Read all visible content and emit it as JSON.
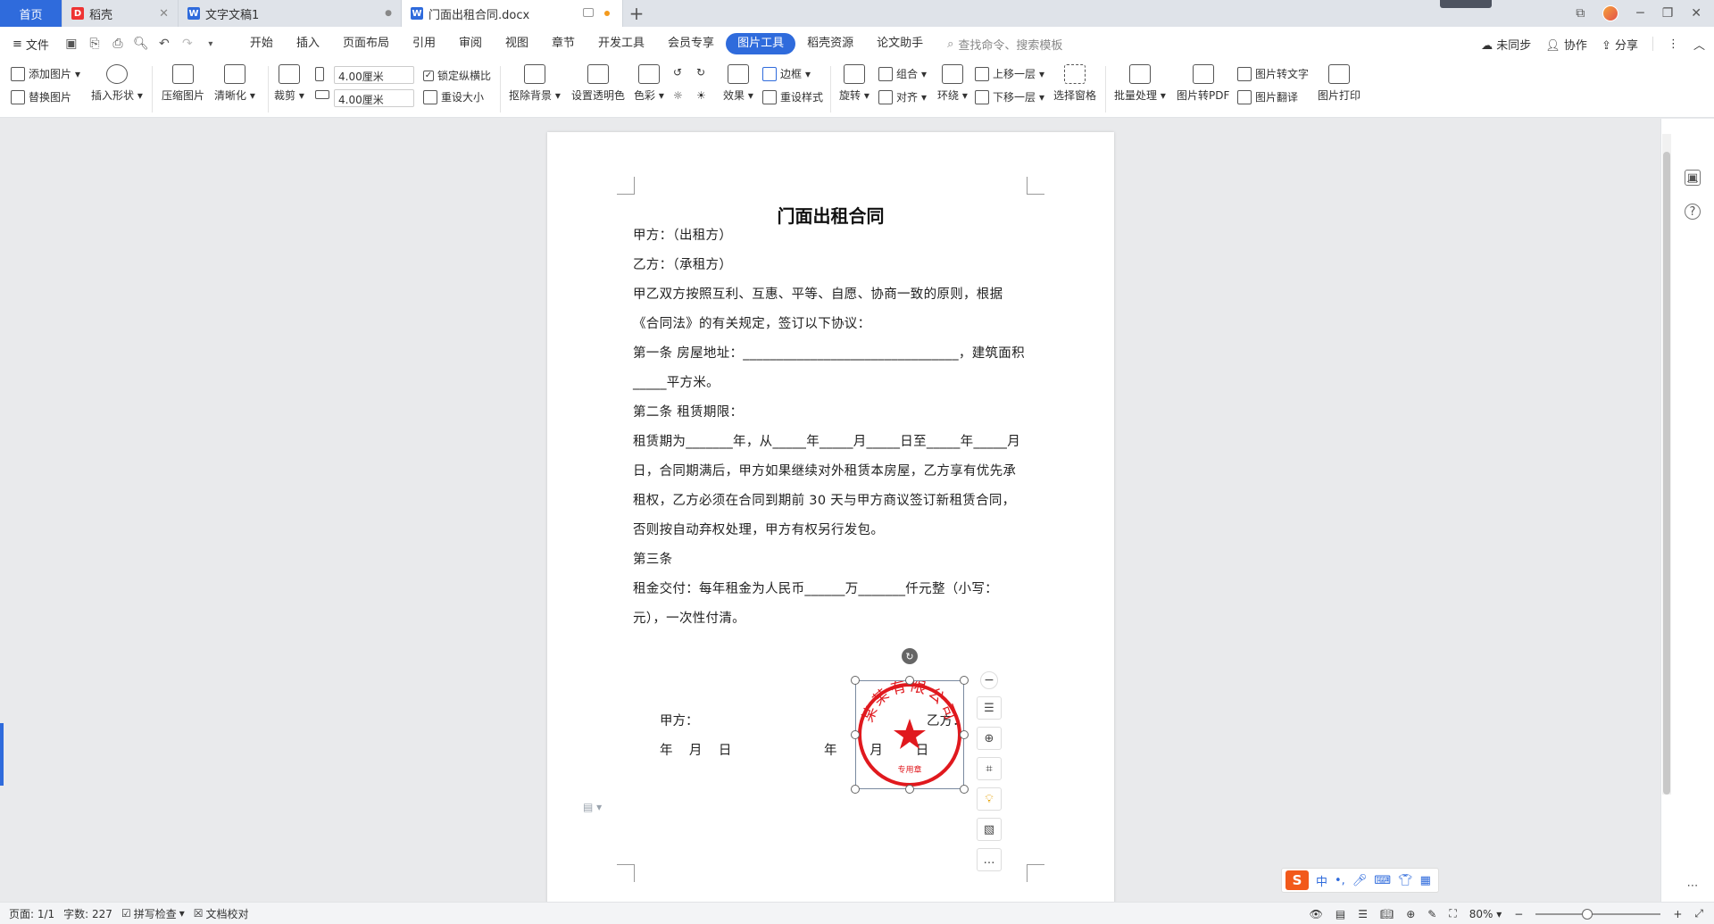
{
  "tabs": [
    {
      "label": "首页",
      "active": false
    },
    {
      "label": "稻壳",
      "active": false
    },
    {
      "label": "文字文稿1",
      "active": false
    },
    {
      "label": "门面出租合同.docx",
      "active": true
    }
  ],
  "menubar": {
    "file_label": "文件",
    "tabs": [
      "开始",
      "插入",
      "页面布局",
      "引用",
      "审阅",
      "视图",
      "章节",
      "开发工具",
      "会员专享",
      "图片工具",
      "稻壳资源",
      "论文助手"
    ],
    "active_tab": "图片工具",
    "search_placeholder": "查找命令、搜索模板",
    "sync_label": "未同步",
    "collab_label": "协作",
    "share_label": "分享"
  },
  "ribbon": {
    "add_picture": "添加图片",
    "replace_picture": "替换图片",
    "insert_shape": "插入形状",
    "compress_picture": "压缩图片",
    "sharpen": "清晰化",
    "crop": "裁剪",
    "width_value": "4.00厘米",
    "height_value": "4.00厘米",
    "lock_ratio": "锁定纵横比",
    "reset_size": "重设大小",
    "remove_bg": "抠除背景",
    "set_transparent": "设置透明色",
    "color": "色彩",
    "effects": "效果",
    "border": "边框",
    "reset_style": "重设样式",
    "rotate": "旋转",
    "group": "组合",
    "align": "对齐",
    "wrap": "环绕",
    "bring_forward": "上移一层",
    "send_backward": "下移一层",
    "selection_pane": "选择窗格",
    "batch_process": "批量处理",
    "to_pdf": "图片转PDF",
    "to_text": "图片转文字",
    "translate": "图片翻译",
    "print": "图片打印"
  },
  "document": {
    "title": "门面出租合同",
    "paragraphs": [
      "甲方：（出租方）",
      "乙方：（承租方）",
      "甲乙双方按照互利、互惠、平等、自愿、协商一致的原则，根据《合同法》的有关规定，签订以下协议：",
      "第一条  房屋地址：________________________________，建筑面积_____平方米。",
      "第二条  租赁期限：",
      "租赁期为_______年，从_____年_____月_____日至_____年_____月日，合同期满后，甲方如果继续对外租赁本房屋，乙方享有优先承租权，乙方必须在合同到期前 30 天与甲方商议签订新租赁合同，否则按自动弃权处理，甲方有权另行发包。",
      "第三条",
      "租金交付：每年租金为人民币______万_______仟元整（小写：元），一次性付清。"
    ],
    "sig_party_a": "甲方：",
    "sig_party_b": "乙方：",
    "sig_date_a": "年    月    日",
    "sig_date_b": "年        月        日",
    "stamp_text": "某某有限公司",
    "stamp_sub": "专用章"
  },
  "statusbar": {
    "page": "页面: 1/1",
    "words": "字数: 227",
    "spellcheck": "拼写检查",
    "proofread": "文档校对",
    "zoom": "80%"
  },
  "ime": {
    "label": "中"
  },
  "colors": {
    "accent": "#2f6bdc",
    "stamp_red": "#e0191e"
  }
}
